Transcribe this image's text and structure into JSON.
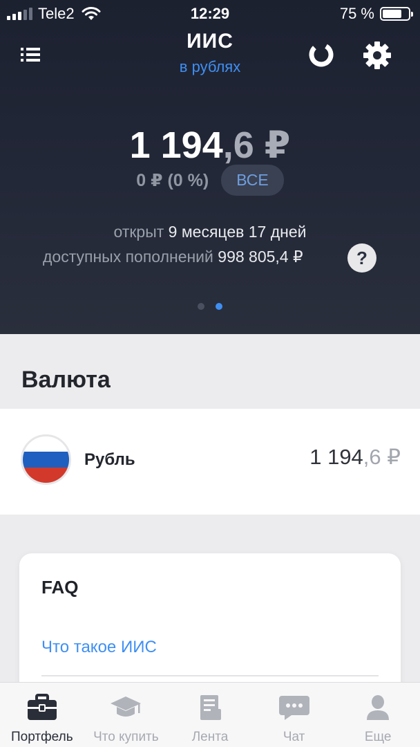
{
  "status_bar": {
    "carrier": "Tele2",
    "time": "12:29",
    "battery": "75 %",
    "battery_level": 0.75
  },
  "header": {
    "title": "ИИС",
    "subtitle": "в рублях"
  },
  "balance": {
    "main": "1 194",
    "fraction": ",6 ₽",
    "change": "0 ₽ (0 %)",
    "all_button": "ВСЕ"
  },
  "info": {
    "opened_label": "открыт",
    "opened_value": "9 месяцев 17 дней",
    "deposits_label": "доступных пополнений",
    "deposits_value": "998 805,4 ₽",
    "help": "?"
  },
  "pager": {
    "count": 2,
    "active": 2
  },
  "currency_section": {
    "title": "Валюта",
    "items": [
      {
        "name": "Рубль",
        "value_main": "1 194",
        "value_fraction": ",6 ₽",
        "flag_colors": [
          "#ffffff",
          "#1f5fbf",
          "#d2392b"
        ]
      }
    ]
  },
  "faq": {
    "title": "FAQ",
    "items": [
      "Что такое ИИС"
    ]
  },
  "tabbar": {
    "items": [
      {
        "label": "Портфель",
        "icon": "briefcase-icon",
        "active": true
      },
      {
        "label": "Что купить",
        "icon": "graduation-cap-icon",
        "active": false
      },
      {
        "label": "Лента",
        "icon": "news-icon",
        "active": false
      },
      {
        "label": "Чат",
        "icon": "chat-icon",
        "active": false
      },
      {
        "label": "Еще",
        "icon": "user-icon",
        "active": false
      }
    ]
  },
  "colors": {
    "accent": "#3f8ff2",
    "header_bg": "#1f2433",
    "tab_active": "#2a2e38",
    "tab_inactive": "#a6a9b0"
  }
}
